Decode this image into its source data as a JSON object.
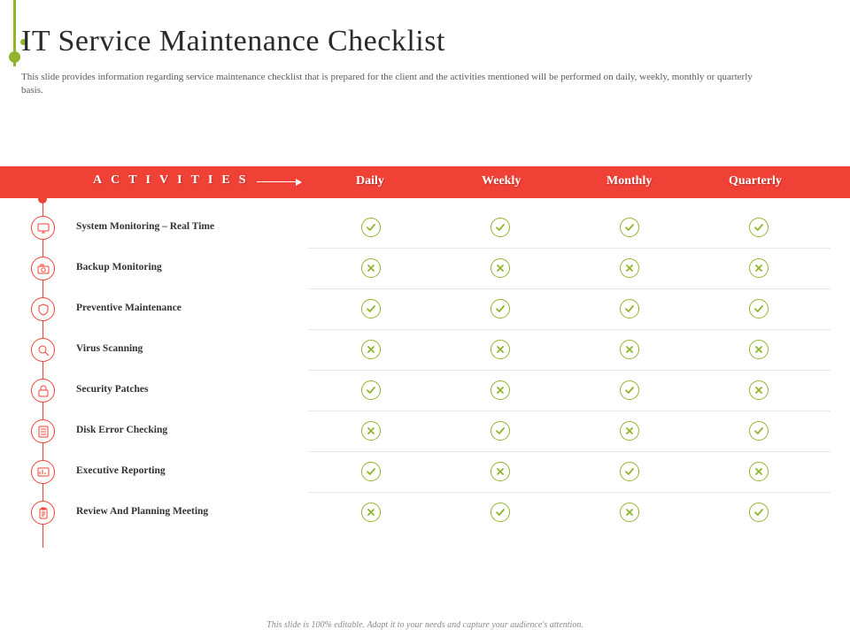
{
  "title": "IT Service Maintenance Checklist",
  "subtitle": "This slide provides information regarding service maintenance checklist that is prepared for the client and the activities mentioned will be performed on daily, weekly, monthly or quarterly basis.",
  "header": {
    "activities": "ACTIVITIES",
    "columns": [
      "Daily",
      "Weekly",
      "Monthly",
      "Quarterly"
    ]
  },
  "rows": [
    {
      "label": "System Monitoring – Real Time",
      "icon": "monitor",
      "status": [
        "check",
        "check",
        "check",
        "check"
      ]
    },
    {
      "label": "Backup Monitoring",
      "icon": "camera",
      "status": [
        "cross",
        "cross",
        "cross",
        "cross"
      ]
    },
    {
      "label": "Preventive Maintenance",
      "icon": "shield",
      "status": [
        "check",
        "check",
        "check",
        "check"
      ]
    },
    {
      "label": "Virus Scanning",
      "icon": "search",
      "status": [
        "cross",
        "cross",
        "cross",
        "cross"
      ]
    },
    {
      "label": "Security Patches",
      "icon": "lock",
      "status": [
        "check",
        "cross",
        "check",
        "cross"
      ]
    },
    {
      "label": "Disk Error Checking",
      "icon": "disk",
      "status": [
        "cross",
        "check",
        "cross",
        "check"
      ]
    },
    {
      "label": "Executive Reporting",
      "icon": "report",
      "status": [
        "check",
        "cross",
        "check",
        "cross"
      ]
    },
    {
      "label": "Review And Planning Meeting",
      "icon": "clipboard",
      "status": [
        "cross",
        "check",
        "cross",
        "check"
      ]
    }
  ],
  "footer": "This slide is 100% editable. Adapt it to your needs and capture your audience's attention."
}
